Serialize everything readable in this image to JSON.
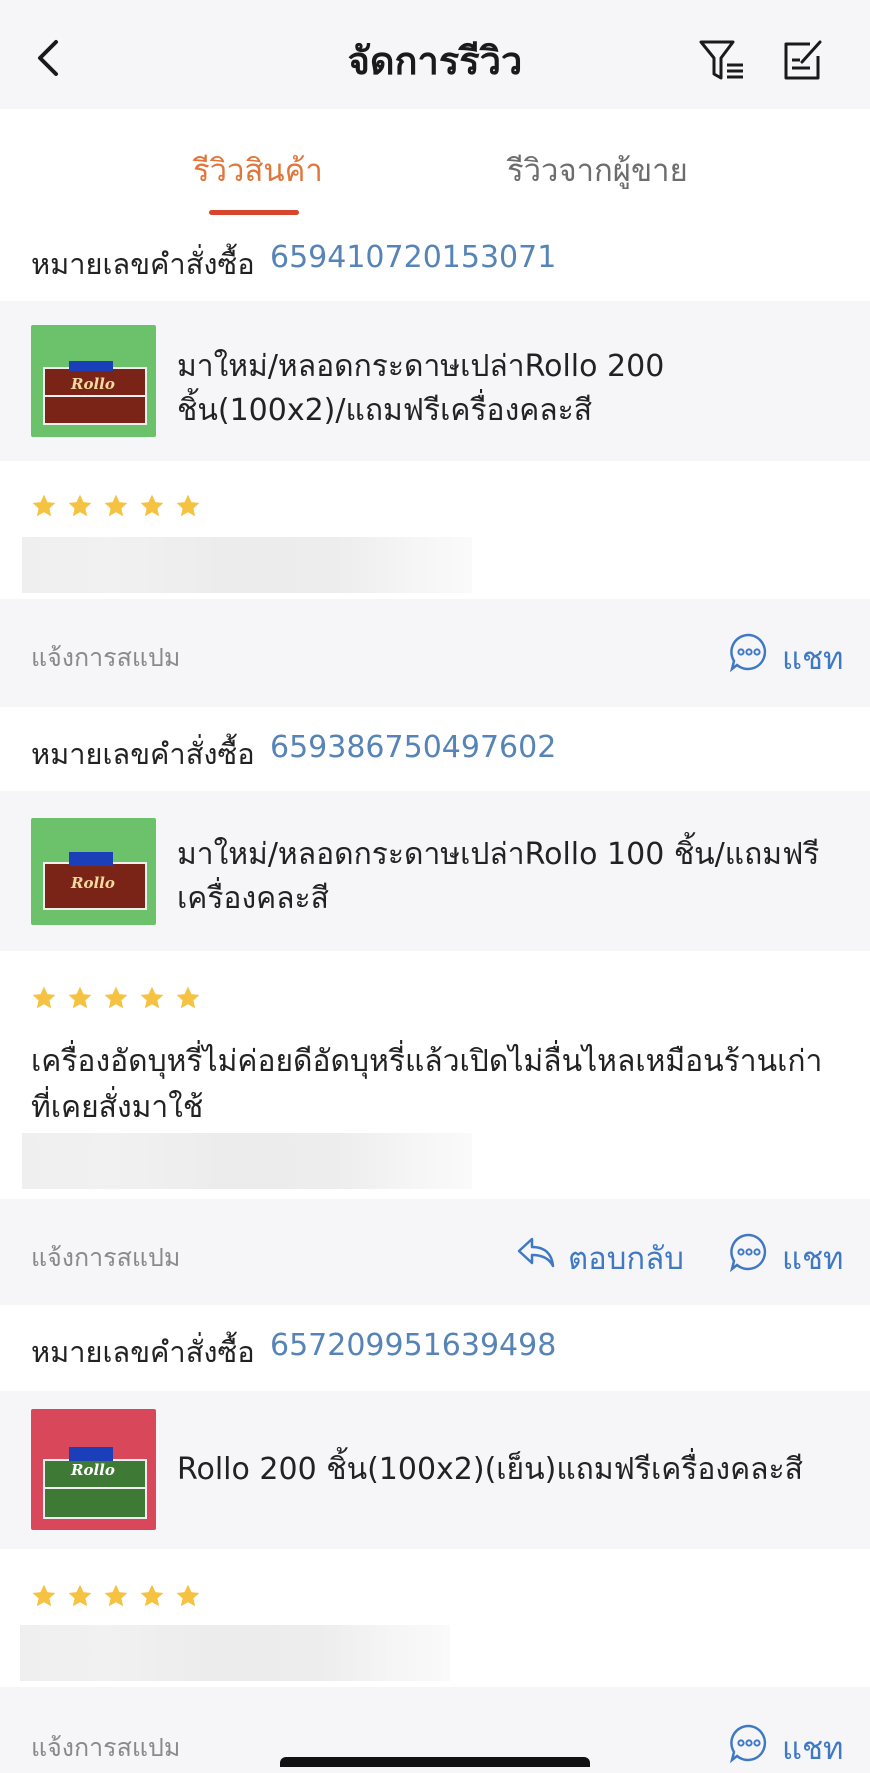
{
  "header": {
    "title": "จัดการรีวิว"
  },
  "tabs": [
    {
      "label": "รีวิวสินค้า"
    },
    {
      "label": "รีวิวจากผู้ขาย"
    }
  ],
  "reviews": [
    {
      "order_label": "หมายเลขคำสั่งซื้อ",
      "order_number": "659410720153071",
      "product_name": "มาใหม่/หลอดกระดาษเปล่าRollo 200 ชิ้น(100x2)/แถมฟรีเครื่องคละสี",
      "thumb_brand": "Rollo",
      "rating": 5,
      "text": "",
      "spam_label": "แจ้งการสแปม",
      "chat_label": "แชท"
    },
    {
      "order_label": "หมายเลขคำสั่งซื้อ",
      "order_number": "659386750497602",
      "product_name": "มาใหม่/หลอดกระดาษเปล่าRollo 100 ชิ้น/แถมฟรีเครื่องคละสี",
      "thumb_brand": "Rollo",
      "rating": 5,
      "text": "เครื่องอัดบุหรี่ไม่ค่อยดีอัดบุหรี่แล้วเปิดไม่ลื่นไหลเหมือนร้านเก่าที่เคยสั่งมาใช้",
      "spam_label": "แจ้งการสแปม",
      "reply_label": "ตอบกลับ",
      "chat_label": "แชท"
    },
    {
      "order_label": "หมายเลขคำสั่งซื้อ",
      "order_number": "657209951639498",
      "product_name": "Rollo 200 ชิ้น(100x2)(เย็น)แถมฟรีเครื่องคละสี",
      "thumb_brand": "Rollo",
      "rating": 5,
      "text": "",
      "spam_label": "แจ้งการสแปม",
      "chat_label": "แชท"
    }
  ],
  "colors": {
    "accent": "#e0763b",
    "tab_indicator": "#d9442c",
    "link": "#3f79c4",
    "order_number": "#5784b6",
    "star": "#f5c242",
    "thumb_green": "#6cc26b",
    "thumb_red": "#d8485a"
  },
  "icons": [
    "back-icon",
    "filter-icon",
    "edit-icon",
    "star-icon",
    "reply-icon",
    "chat-icon"
  ]
}
